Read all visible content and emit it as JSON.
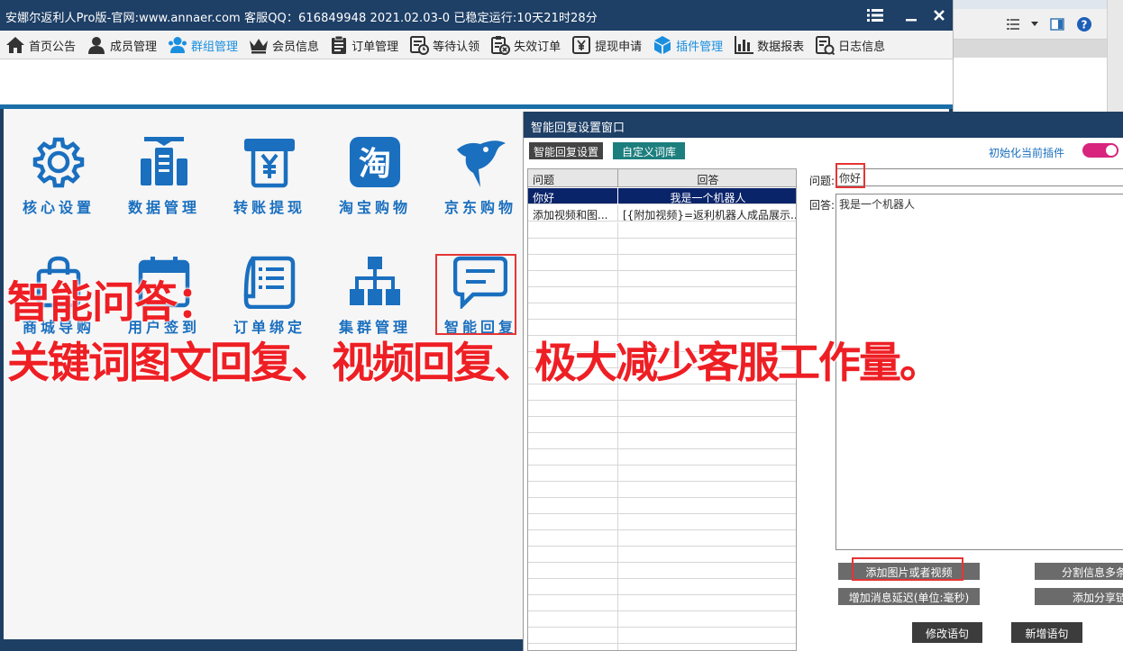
{
  "window": {
    "title": "安娜尔返利人Pro版-官网:www.annaer.com 客服QQ：616849948  2021.02.03-0  已稳定运行:10天21时28分"
  },
  "menu": {
    "items": [
      {
        "label": "首页公告",
        "icon": "home-icon"
      },
      {
        "label": "成员管理",
        "icon": "person-icon"
      },
      {
        "label": "群组管理",
        "icon": "group-icon",
        "active": true
      },
      {
        "label": "会员信息",
        "icon": "crown-icon"
      },
      {
        "label": "订单管理",
        "icon": "clipboard-icon"
      },
      {
        "label": "等待认领",
        "icon": "wait-icon"
      },
      {
        "label": "失效订单",
        "icon": "invalid-order-icon"
      },
      {
        "label": "提现申请",
        "icon": "yen-icon"
      },
      {
        "label": "插件管理",
        "icon": "cube-icon",
        "active": true
      },
      {
        "label": "数据报表",
        "icon": "bar-chart-icon"
      },
      {
        "label": "日志信息",
        "icon": "log-icon"
      }
    ]
  },
  "plugins": [
    {
      "label": "核心设置",
      "icon": "gear-icon"
    },
    {
      "label": "数据管理",
      "icon": "data-manage-icon"
    },
    {
      "label": "转账提现",
      "icon": "transfer-icon"
    },
    {
      "label": "淘宝购物",
      "icon": "taobao-icon",
      "glyph": "淘"
    },
    {
      "label": "京东购物",
      "icon": "jd-icon"
    },
    {
      "label": "商城导购",
      "icon": "mall-icon"
    },
    {
      "label": "用户签到",
      "icon": "calendar-icon"
    },
    {
      "label": "订单绑定",
      "icon": "order-bind-icon"
    },
    {
      "label": "集群管理",
      "icon": "cluster-icon"
    },
    {
      "label": "智能回复",
      "icon": "chat-icon"
    }
  ],
  "banner": {
    "line1": "智能问答：",
    "line2": "关键词图文回复、视频回复、极大减少客服工作量。"
  },
  "dialog": {
    "title": "智能回复设置窗口",
    "tabs": [
      "智能回复设置",
      "自定义词库"
    ],
    "init_label": "初始化当前插件",
    "toggle_on": true,
    "table": {
      "columns": [
        "问题",
        "回答"
      ],
      "rows": [
        {
          "q": "你好",
          "a": "我是一个机器人",
          "selected": true
        },
        {
          "q": "添加视频和图...",
          "a": "[{附加视频}=返利机器人成品展示..."
        }
      ]
    },
    "question_label": "问题:",
    "question_value": "你好",
    "answer_label": "回答:",
    "answer_value": "我是一个机器人",
    "buttons": {
      "add_media": "添加图片或者视频",
      "split_msg": "分割信息多条",
      "add_delay": "增加消息延迟(单位:毫秒)",
      "add_share": "添加分享链接",
      "modify": "修改语句",
      "new": "新增语句"
    }
  },
  "colors": {
    "title_bar": "#1e3f66",
    "accent_blue": "#1a8fe0",
    "plugin_blue": "#1a6fbf",
    "banner_red": "#ee1f24",
    "toggle_pink": "#d8247c",
    "highlight_box": "#e53535"
  }
}
